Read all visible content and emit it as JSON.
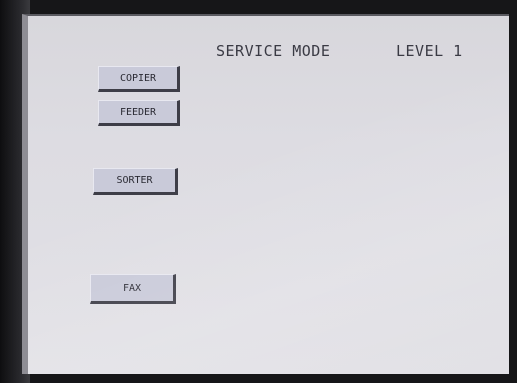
{
  "screen": {
    "title": "SERVICE MODE",
    "level": "LEVEL 1"
  },
  "buttons": {
    "copier": "COPIER",
    "feeder": "FEEDER",
    "sorter": "SORTER",
    "fax": "FAX"
  }
}
